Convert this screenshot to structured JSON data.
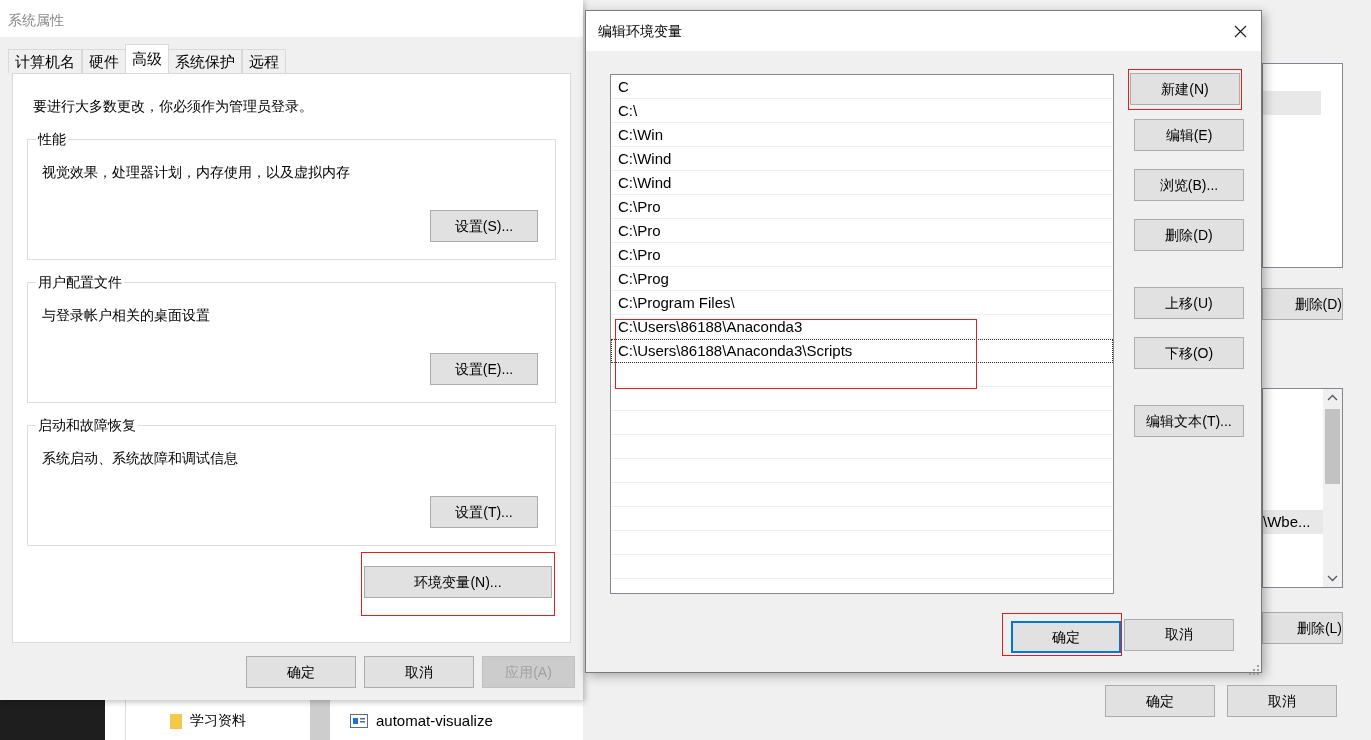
{
  "background_window": {
    "list_item": "\\Wbe...",
    "buttons": [
      {
        "label": "删除(D)"
      },
      {
        "label": "删除(L)"
      },
      {
        "label": "确定"
      },
      {
        "label": "取消"
      }
    ]
  },
  "explorer": {
    "folders": [
      {
        "name": "学习资料"
      }
    ],
    "files": [
      {
        "name": "automat-visualize"
      }
    ]
  },
  "system_properties": {
    "title": "系统属性",
    "tabs": [
      {
        "label": "计算机名",
        "selected": false
      },
      {
        "label": "硬件",
        "selected": false
      },
      {
        "label": "高级",
        "selected": true
      },
      {
        "label": "系统保护",
        "selected": false
      },
      {
        "label": "远程",
        "selected": false
      }
    ],
    "notice": "要进行大多数更改，你必须作为管理员登录。",
    "groups": [
      {
        "title": "性能",
        "description": "视觉效果，处理器计划，内存使用，以及虚拟内存",
        "button": "设置(S)..."
      },
      {
        "title": "用户配置文件",
        "description": "与登录帐户相关的桌面设置",
        "button": "设置(E)..."
      },
      {
        "title": "启动和故障恢复",
        "description": "系统启动、系统故障和调试信息",
        "button": "设置(T)..."
      }
    ],
    "env_button": {
      "label": "环境变量(N)...",
      "annotated": true
    },
    "buttons": [
      {
        "label": "确定",
        "disabled": false
      },
      {
        "label": "取消",
        "disabled": false
      },
      {
        "label": "应用(A)",
        "disabled": true
      }
    ]
  },
  "edit_env": {
    "title": "编辑环境变量",
    "paths": [
      {
        "text": "C",
        "highlighted": false,
        "focused": false
      },
      {
        "text": "C:\\",
        "highlighted": false,
        "focused": false
      },
      {
        "text": "C:\\Win",
        "highlighted": false,
        "focused": false
      },
      {
        "text": "C:\\Wind",
        "highlighted": false,
        "focused": false
      },
      {
        "text": "C:\\Wind",
        "highlighted": false,
        "focused": false
      },
      {
        "text": "C:\\Pro",
        "highlighted": false,
        "focused": false
      },
      {
        "text": "C:\\Pro",
        "highlighted": false,
        "focused": false
      },
      {
        "text": "C:\\Pro",
        "highlighted": false,
        "focused": false
      },
      {
        "text": "C:\\Prog",
        "highlighted": false,
        "focused": false
      },
      {
        "text": "C:\\Program Files\\",
        "highlighted": false,
        "focused": false
      },
      {
        "text": "C:\\Users\\86188\\Anaconda3",
        "highlighted": true,
        "focused": false
      },
      {
        "text": "C:\\Users\\86188\\Anaconda3\\Scripts",
        "highlighted": true,
        "focused": true
      }
    ],
    "side_buttons": [
      {
        "label": "新建(N)",
        "annotated": true
      },
      {
        "label": "编辑(E)",
        "annotated": false
      },
      {
        "label": "浏览(B)...",
        "annotated": false
      },
      {
        "label": "删除(D)",
        "annotated": false
      },
      {
        "label": "上移(U)",
        "annotated": false
      },
      {
        "label": "下移(O)",
        "annotated": false
      },
      {
        "label": "编辑文本(T)...",
        "annotated": false
      }
    ],
    "buttons": [
      {
        "label": "确定",
        "annotated": true,
        "default": true
      },
      {
        "label": "取消",
        "annotated": false,
        "default": false
      }
    ]
  }
}
